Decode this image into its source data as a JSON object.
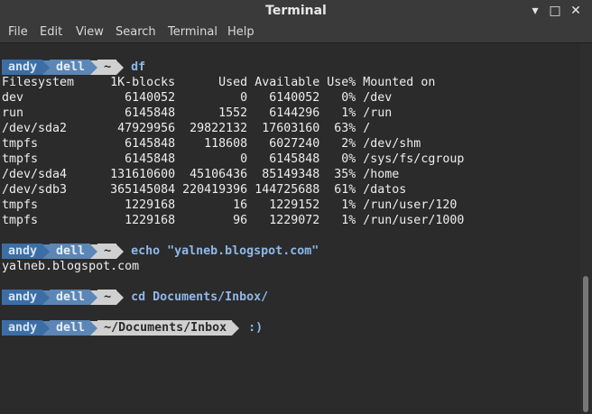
{
  "window": {
    "title": "Terminal",
    "minimize_label": "▾",
    "maximize_label": "□",
    "close_label": "✕"
  },
  "menu": [
    "File",
    "Edit",
    "View",
    "Search",
    "Terminal",
    "Help"
  ],
  "prompt": {
    "user": "andy",
    "host": "dell"
  },
  "commands": [
    {
      "path": "~",
      "cmd": "df"
    },
    {
      "path": "~",
      "cmd": "echo \"yalneb.blogspot.com\""
    },
    {
      "path": "~",
      "cmd": "cd Documents/Inbox/"
    },
    {
      "path": "~/Documents/Inbox",
      "cmd": ":)"
    }
  ],
  "df_output": [
    "Filesystem     1K-blocks      Used Available Use% Mounted on",
    "dev              6140052         0   6140052   0% /dev",
    "run              6145848      1552   6144296   1% /run",
    "/dev/sda2       47929956  29822132  17603160  63% /",
    "tmpfs            6145848    118608   6027240   2% /dev/shm",
    "tmpfs            6145848         0   6145848   0% /sys/fs/cgroup",
    "/dev/sda4      131610600  45106436  85149348  35% /home",
    "/dev/sdb3      365145084 220419396 144725688  61% /datos",
    "tmpfs            1229168        16   1229152   1% /run/user/120",
    "tmpfs            1229168        96   1229072   1% /run/user/1000"
  ],
  "echo_output": "yalneb.blogspot.com",
  "colors": {
    "user_bg": "#3c6ea5",
    "host_bg": "#5b86b5",
    "path_bg": "#d0d0d0",
    "command": "#8fb8ea",
    "terminal_bg": "#2b2b2b"
  }
}
